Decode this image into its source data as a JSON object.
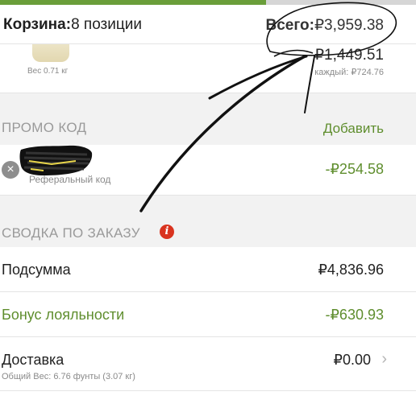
{
  "header": {
    "cart_label": "Корзина:",
    "cart_count": "8 позиции",
    "total_label": "Всего:",
    "total_value": "₽3,959.38"
  },
  "product": {
    "weight": "Вес 0.71 кг",
    "price": "₽1,449.51",
    "each": "каждый: ₽724.76"
  },
  "promo": {
    "section_title": "ПРОМО КОД",
    "add_label": "Добавить",
    "code_type": "Реферальный код",
    "discount": "-₽254.58",
    "remove_icon": "×"
  },
  "summary": {
    "section_title": "СВОДКА ПО ЗАКАЗУ",
    "info_icon": "i",
    "rows": [
      {
        "label": "Подсумма",
        "value": "₽4,836.96"
      },
      {
        "label": "Бонус лояльности",
        "value": "-₽630.93"
      },
      {
        "label": "Доставка",
        "value": "₽0.00",
        "sub": "Общий Вес: 6.76 фунты (3.07 кг)"
      }
    ],
    "chevron": "›"
  },
  "colors": {
    "accent_green": "#5f8e2e",
    "info_red": "#d9331f"
  }
}
